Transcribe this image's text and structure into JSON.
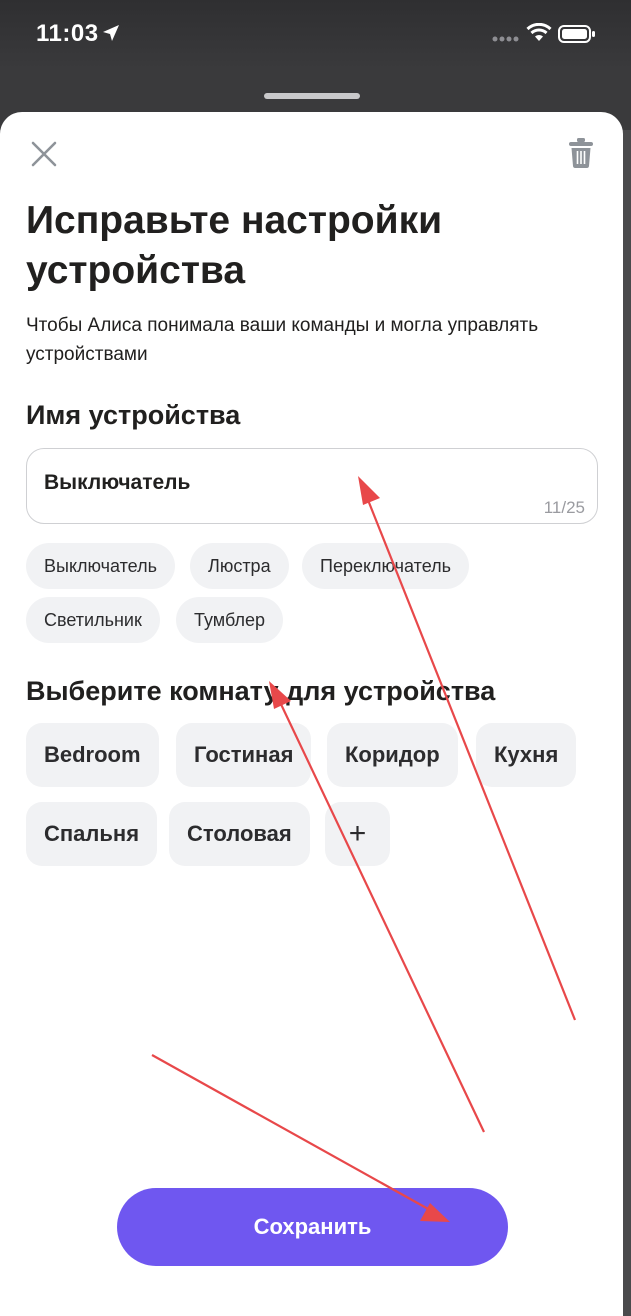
{
  "status_bar": {
    "time": "11:03"
  },
  "header": {
    "close_icon": "close-icon",
    "delete_icon": "trash-icon"
  },
  "title": "Исправьте настройки устройства",
  "subtitle": "Чтобы Алиса понимала ваши команды и могла управлять устройствами",
  "device_name": {
    "label": "Имя устройства",
    "value": "Выключатель",
    "counter": "11/25"
  },
  "name_suggestions": [
    "Выключатель",
    "Люстра",
    "Переключатель",
    "Светильник",
    "Тумблер"
  ],
  "room_section": {
    "label": "Выберите комнату для устройства",
    "rooms": [
      "Bedroom",
      "Гостиная",
      "Коридор",
      "Кухня",
      "Спальня",
      "Столовая"
    ],
    "add_label": "+"
  },
  "save_button": {
    "label": "Сохранить"
  },
  "colors": {
    "accent": "#6f57f0",
    "chip_bg": "#f1f2f4",
    "annotation": "#e8484a"
  }
}
